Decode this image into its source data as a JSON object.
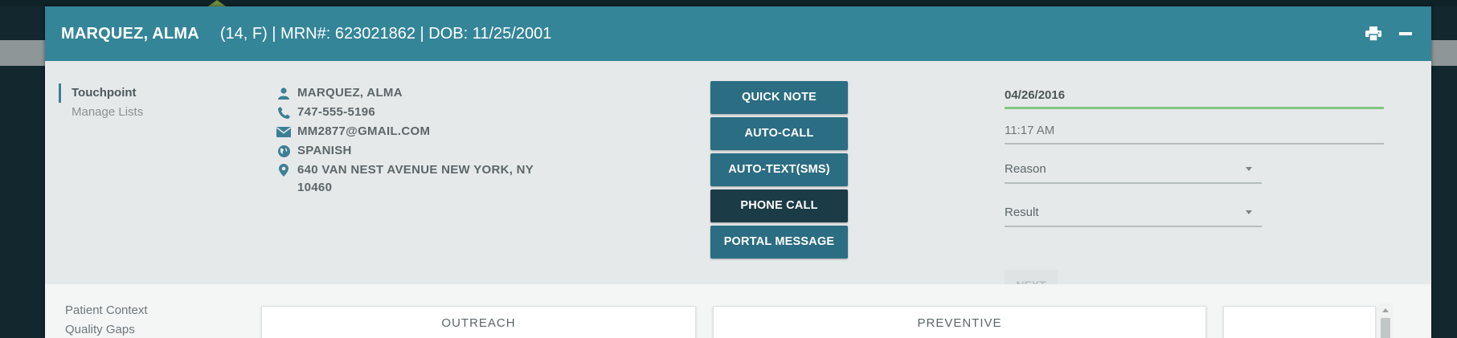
{
  "header": {
    "patient_name": "MARQUEZ, ALMA",
    "patient_meta": "(14, F) | MRN#: 623021862 | DOB: 11/25/2001",
    "print_icon": "print-icon",
    "minimize_icon": "minimize-icon"
  },
  "left_nav": {
    "items": [
      {
        "label": "Touchpoint",
        "active": true
      },
      {
        "label": "Manage Lists",
        "active": false
      }
    ]
  },
  "contact": {
    "name": "MARQUEZ, ALMA",
    "phone": "747-555-5196",
    "email": "MM2877@GMAIL.COM",
    "language": "SPANISH",
    "address": "640 VAN NEST AVENUE NEW YORK, NY 10460",
    "icons": [
      "person-icon",
      "phone-icon",
      "envelope-icon",
      "globe-icon",
      "map-pin-icon"
    ]
  },
  "actions": {
    "quick_note": "QUICK NOTE",
    "auto_call": "AUTO-CALL",
    "auto_text": "AUTO-TEXT(SMS)",
    "phone_call": "PHONE CALL",
    "portal_message": "PORTAL MESSAGE"
  },
  "form": {
    "date": "04/26/2016",
    "time": "11:17 AM",
    "reason": "Reason",
    "result": "Result",
    "next": "NEXT"
  },
  "bottom_nav": {
    "items": [
      "Patient Context",
      "Quality Gaps"
    ]
  },
  "cards": {
    "outreach": "OUTREACH",
    "preventive": "PREVENTIVE"
  },
  "colors": {
    "header": "#348598",
    "button": "#2b6d82",
    "button_active": "#1b3b46",
    "date_underline": "#7ec77e"
  }
}
